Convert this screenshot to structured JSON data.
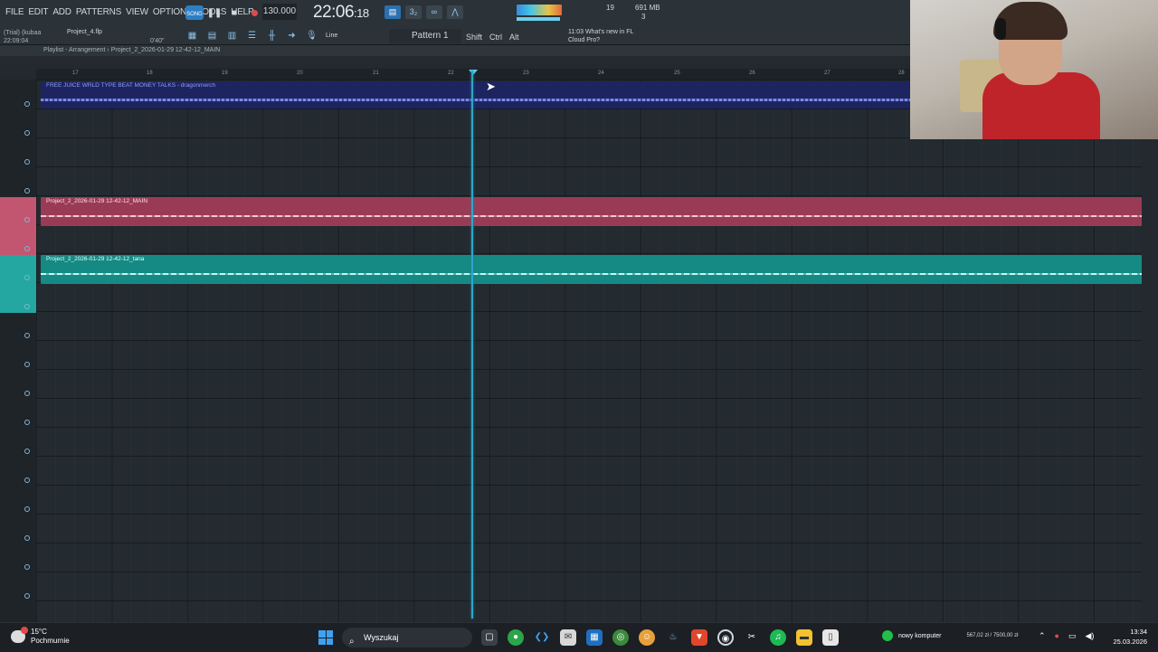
{
  "menu": [
    "FILE",
    "EDIT",
    "ADD",
    "PATTERNS",
    "VIEW",
    "OPTIONS",
    "TOOLS",
    "HELP"
  ],
  "toolbar": {
    "song_label": "SONG",
    "tempo": "130.000",
    "clock_main": "22:06",
    "clock_sub": "18",
    "cpu": "19",
    "memory": "691 MB",
    "polyphony": "3",
    "trial_user": "(Trial) (kubaa",
    "trial_time": "22:09:04",
    "project_file": "Project_4.flp",
    "time_pos": "0'40\"",
    "snap": "Line",
    "pattern": "Pattern 1",
    "mod_shift": "Shift",
    "mod_ctrl": "Ctrl",
    "mod_alt": "Alt",
    "news_time": "11:03",
    "news_line1": "What's new in FL",
    "news_line2": "Cloud Pro?"
  },
  "playlist": {
    "header": "Playlist - Arrangement › Project_2_2026-01-29 12-42-12_MAIN",
    "ruler": [
      "17",
      "18",
      "19",
      "20",
      "21",
      "22",
      "23",
      "24",
      "25",
      "26",
      "27",
      "28"
    ],
    "clips": [
      {
        "title": "FREE JUICE WRLD TYPE BEAT MONEY TALKS - dragonmerch",
        "color": "#2f3f8e",
        "wave": "#6d7fd8"
      },
      {
        "title": "Project_2_2026-01-29 12-42-12_MAIN",
        "color": "#b04a68",
        "wave": "#f0c8d6"
      },
      {
        "title": "Project_2_2026-01-29 12-42-12_tana",
        "color": "#1f9a93",
        "wave": "#b8f3ee"
      }
    ]
  },
  "taskbar": {
    "temp": "15°C",
    "weather": "Pochmurnie",
    "search_placeholder": "Wyszukaj",
    "tray_app_label": "nowy komputer",
    "tray_app_value": "567,02 zł / 7500,00 zł",
    "time": "13:34",
    "date": "25.03.2026"
  }
}
